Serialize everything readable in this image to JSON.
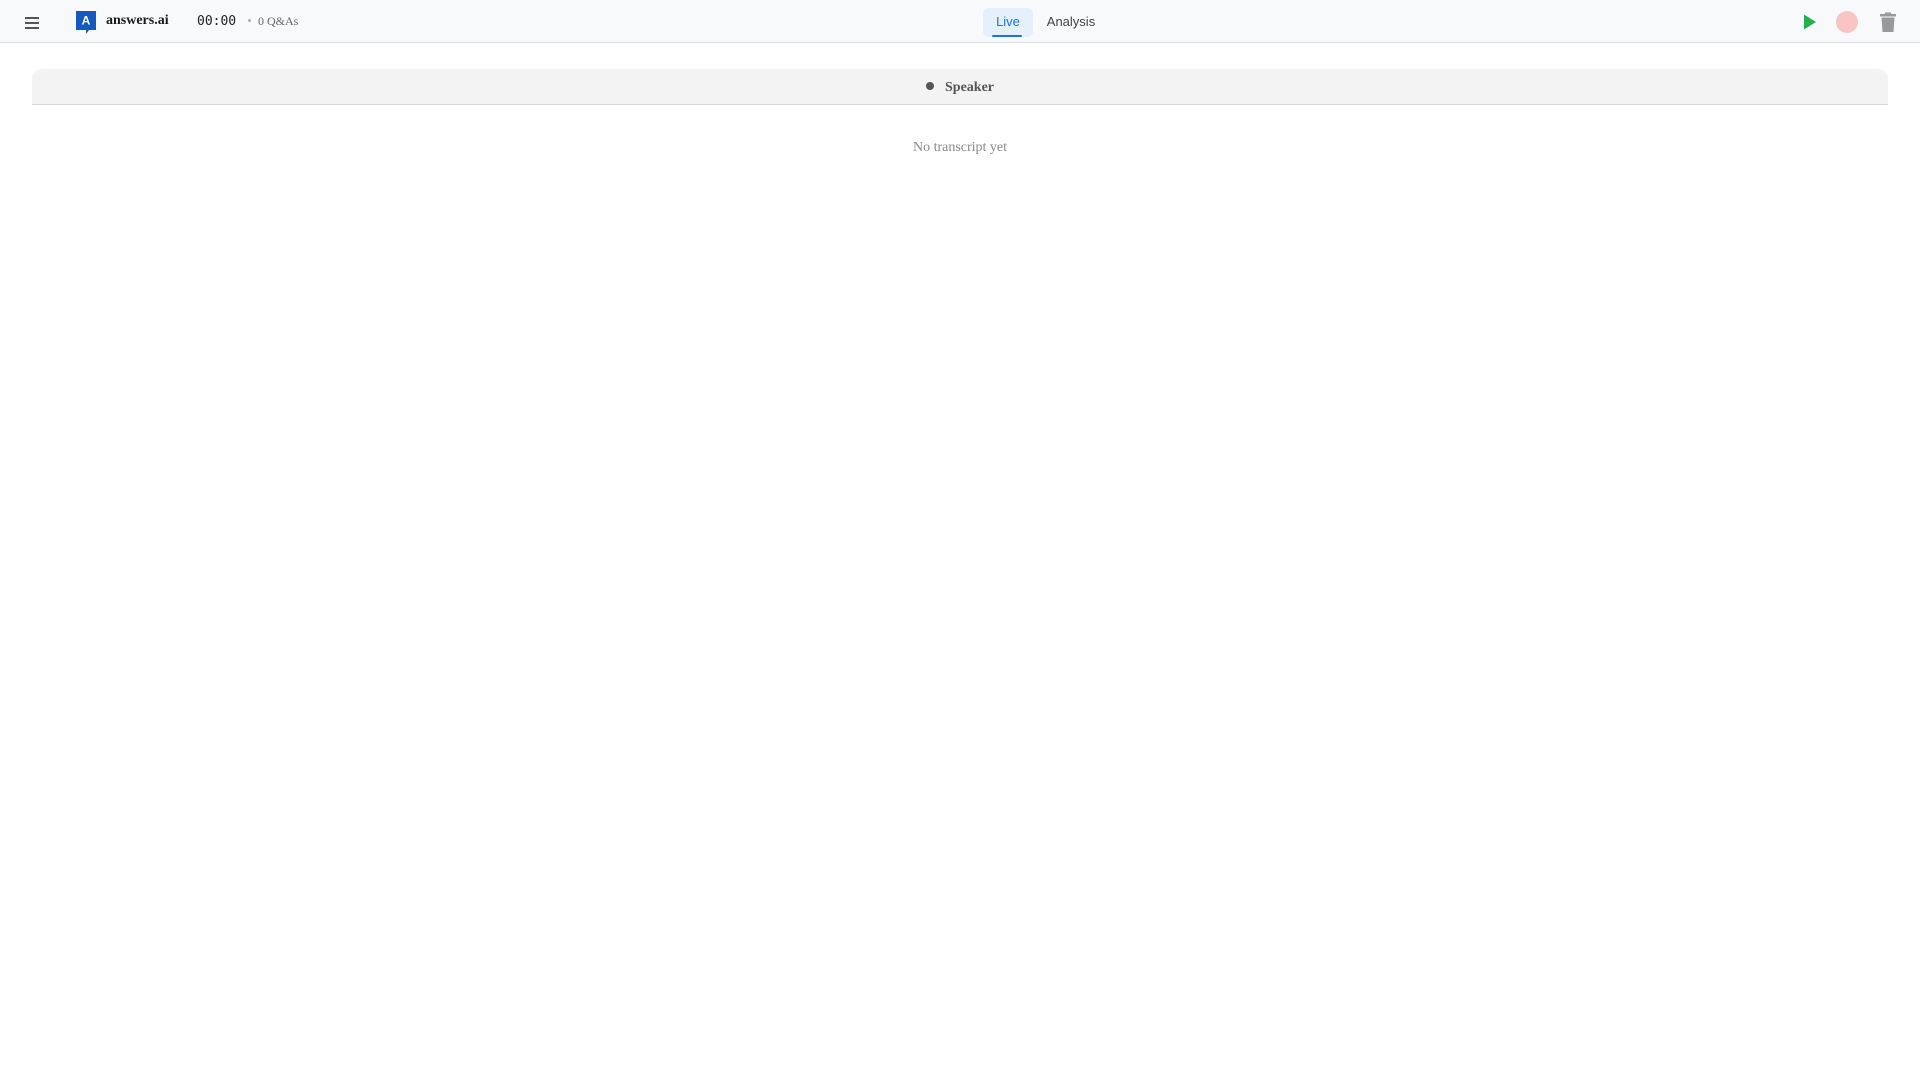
{
  "header": {
    "brand_name": "answers.ai",
    "logo_letter": "A",
    "timer": "00:00",
    "qa_count": "0 Q&As",
    "accent_color": "#1a73e8",
    "logo_color": "#1558c0"
  },
  "tabs": [
    {
      "label": "Live",
      "active": true
    },
    {
      "label": "Analysis",
      "active": false
    }
  ],
  "controls": {
    "play_icon": "play-icon",
    "record_icon": "record-icon",
    "trash_icon": "trash-icon",
    "play_color": "#22b14c",
    "record_color": "#f8c4c4",
    "trash_color": "#999999"
  },
  "transcript": {
    "speaker_label": "Speaker",
    "empty_message": "No transcript yet"
  }
}
